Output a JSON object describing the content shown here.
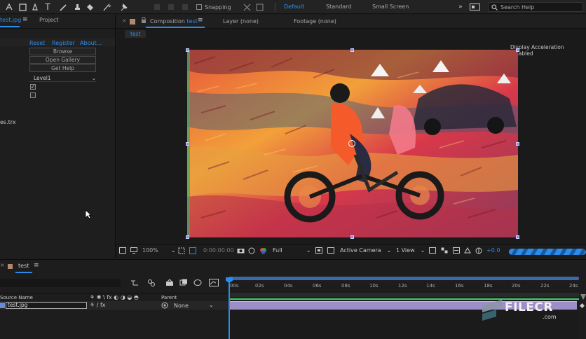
{
  "toolbar": {
    "snapping_label": "Snapping",
    "workspaces": [
      "Default",
      "Standard",
      "Small Screen"
    ],
    "active_workspace": "Default",
    "search_placeholder": "Search Help"
  },
  "left_panel": {
    "tabs": [
      {
        "label": "test.jpg",
        "active": true
      },
      {
        "label": "Project",
        "active": false
      }
    ],
    "effect_links": [
      "Reset",
      "Register",
      "About..."
    ],
    "buttons": [
      "Browse",
      "Open Gallery",
      "Get Help"
    ],
    "level_value": "Level1",
    "file_label": "es.trx"
  },
  "comp_panel": {
    "tab_composition_prefix": "Composition",
    "tab_composition_name": "test",
    "tab_layer": "Layer (none)",
    "tab_footage": "Footage (none)",
    "comp_chip": "test",
    "display_accel": "Display Acceleration Disabled"
  },
  "comp_footer": {
    "zoom": "100%",
    "timecode": "0:00:00:00",
    "resolution": "Full",
    "camera": "Active Camera",
    "views": "1 View",
    "exposure": "+0.0"
  },
  "timeline": {
    "tab_label": "test",
    "column_source": "Source Name",
    "column_parent": "Parent",
    "layer_name": "test.jpg",
    "parent_value": "None",
    "ruler": [
      "00s",
      "02s",
      "04s",
      "06s",
      "08s",
      "10s",
      "12s",
      "14s",
      "16s",
      "18s",
      "20s",
      "22s",
      "24s"
    ]
  },
  "watermark": {
    "text": "FILECR",
    "sub": ".com"
  },
  "colors": {
    "accent": "#2d8ceb",
    "panel_bg": "#1d1d1d",
    "layer_bar": "#9c8ec7",
    "work_area": "#3ccf6d"
  }
}
